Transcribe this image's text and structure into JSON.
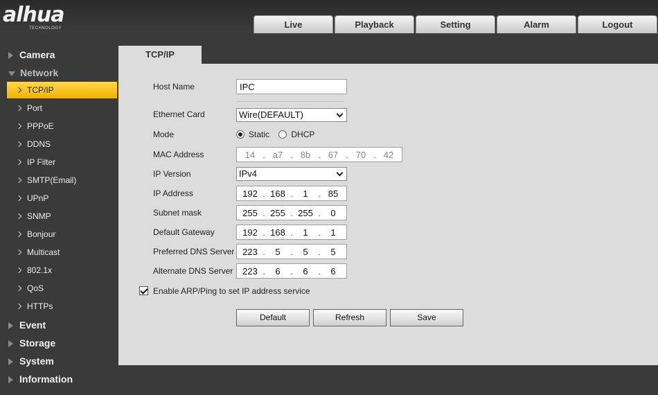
{
  "brand": {
    "logo": "alhua",
    "tagline": "TECHNOLOGY"
  },
  "nav": [
    "Live",
    "Playback",
    "Setting",
    "Alarm",
    "Logout"
  ],
  "sidebar": {
    "camera": "Camera",
    "network": "Network",
    "items": [
      "TCP/IP",
      "Port",
      "PPPoE",
      "DDNS",
      "IP Filter",
      "SMTP(Email)",
      "UPnP",
      "SNMP",
      "Bonjour",
      "Multicast",
      "802.1x",
      "QoS",
      "HTTPs"
    ],
    "event": "Event",
    "storage": "Storage",
    "system": "System",
    "information": "Information"
  },
  "page": {
    "tab": "TCP/IP"
  },
  "form": {
    "host_name": {
      "label": "Host Name",
      "value": "IPC"
    },
    "ethernet_card": {
      "label": "Ethernet Card",
      "value": "Wire(DEFAULT)"
    },
    "mode": {
      "label": "Mode",
      "static": "Static",
      "dhcp": "DHCP",
      "selected": "Static"
    },
    "mac": {
      "label": "MAC Address",
      "octets": [
        "14",
        "a7",
        "8b",
        "67",
        "70",
        "42"
      ]
    },
    "ip_version": {
      "label": "IP Version",
      "value": "IPv4"
    },
    "ip_address": {
      "label": "IP Address",
      "octets": [
        "192",
        "168",
        "1",
        "85"
      ]
    },
    "subnet": {
      "label": "Subnet mask",
      "octets": [
        "255",
        "255",
        "255",
        "0"
      ]
    },
    "gateway": {
      "label": "Default Gateway",
      "octets": [
        "192",
        "168",
        "1",
        "1"
      ]
    },
    "dns1": {
      "label": "Preferred DNS Server",
      "octets": [
        "223",
        "5",
        "5",
        "5"
      ]
    },
    "dns2": {
      "label": "Alternate DNS Server",
      "octets": [
        "223",
        "6",
        "6",
        "6"
      ]
    },
    "arp": {
      "label": "Enable ARP/Ping to set IP address service",
      "checked": true
    }
  },
  "buttons": {
    "default": "Default",
    "refresh": "Refresh",
    "save": "Save"
  }
}
